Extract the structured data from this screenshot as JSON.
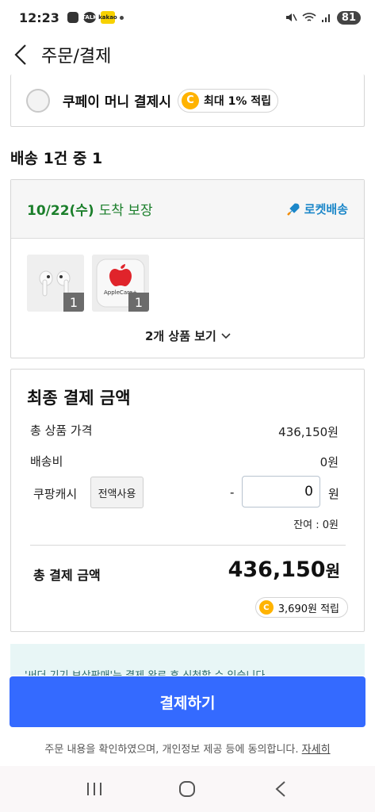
{
  "status_bar": {
    "time": "12:23",
    "talk": "TALK",
    "kakao": "kakao",
    "battery": "81"
  },
  "header": {
    "title": "주문/결제"
  },
  "payment_option": {
    "label": "쿠페이 머니 결제시",
    "coin": "C",
    "reward": "최대 1% 적립"
  },
  "shipment": {
    "heading": "배송 1건 중 1",
    "date": "10/22(수)",
    "guarantee": "도착 보장",
    "badge": "로켓배송",
    "products": [
      {
        "name": "airpods",
        "qty": "1"
      },
      {
        "name": "applecare",
        "brand": "AppleCare+",
        "qty": "1"
      }
    ],
    "view_products": "2개 상품 보기"
  },
  "totals": {
    "title": "최종 결제 금액",
    "product_price_label": "총 상품 가격",
    "product_price": "436,150원",
    "shipping_label": "배송비",
    "shipping": "0원",
    "cash_label": "쿠팡캐시",
    "use_all": "전액사용",
    "minus": "-",
    "cash_value": "0",
    "cash_unit": "원",
    "balance": "잔여 : 0원",
    "grand_label": "총 결제 금액",
    "grand_value": "436,150",
    "grand_unit": "원",
    "earn_coin": "C",
    "earn": "3,690원 적립"
  },
  "notice": {
    "text": "'써더 기기 보상판매'는 결제 완료 후 신청할 수 있습니다"
  },
  "pay_button": "결제하기",
  "consent": {
    "text": "주문 내용을 확인하였으며, 개인정보 제공 등에 동의합니다.",
    "link": "자세히"
  },
  "nav": {
    "recents": "recents-icon",
    "home": "home-icon",
    "back": "back-icon"
  },
  "colors": {
    "accent": "#346aff",
    "delivery": "#1b7f2b",
    "rocket": "#1c87c9",
    "coin": "#ffb300"
  }
}
